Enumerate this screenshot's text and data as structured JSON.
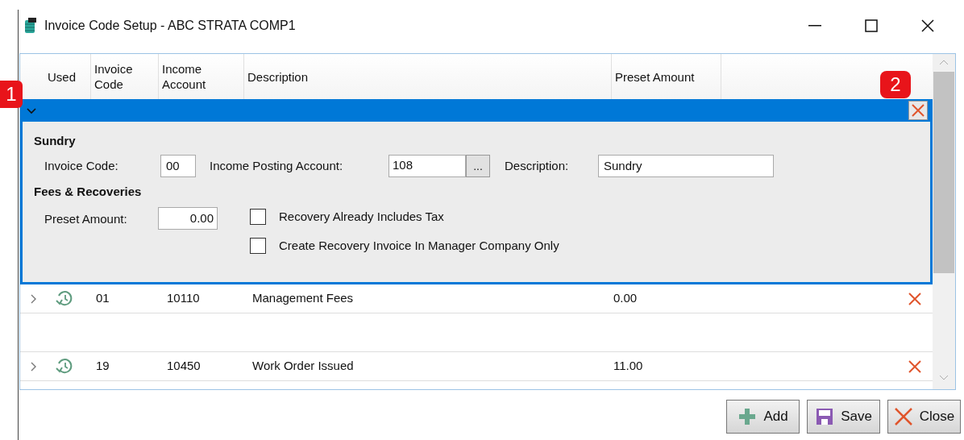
{
  "window": {
    "title": "Invoice Code Setup - ABC STRATA COMP1"
  },
  "callouts": [
    "1",
    "2"
  ],
  "table": {
    "columns": [
      "Used",
      "Invoice Code",
      "Income Account",
      "Description",
      "Preset Amount"
    ],
    "expanded_row": {
      "expanded": true,
      "section_1": "Sundry",
      "invoice_code_label": "Invoice Code:",
      "invoice_code": "00",
      "income_account_label": "Income Posting Account:",
      "income_account": "108",
      "browse_button": "...",
      "description_label": "Description:",
      "description": "Sundry",
      "section_2": "Fees & Recoveries",
      "preset_amount_label": "Preset Amount:",
      "preset_amount": "0.00",
      "options": [
        {
          "label": "Recovery Already Includes Tax",
          "checked": false
        },
        {
          "label": "Create Recovery Invoice In Manager Company Only",
          "checked": false
        }
      ]
    },
    "rows": [
      {
        "invoice_code": "01",
        "income_account": "10110",
        "description": "Management Fees",
        "preset_amount": "0.00",
        "expanded": false
      },
      {
        "invoice_code": "19",
        "income_account": "10450",
        "description": "Work Order Issued",
        "preset_amount": "11.00",
        "expanded": false
      }
    ]
  },
  "buttons": [
    {
      "kind": "add",
      "label": "Add"
    },
    {
      "kind": "save",
      "label": "Save"
    },
    {
      "kind": "close",
      "label": "Close"
    }
  ]
}
